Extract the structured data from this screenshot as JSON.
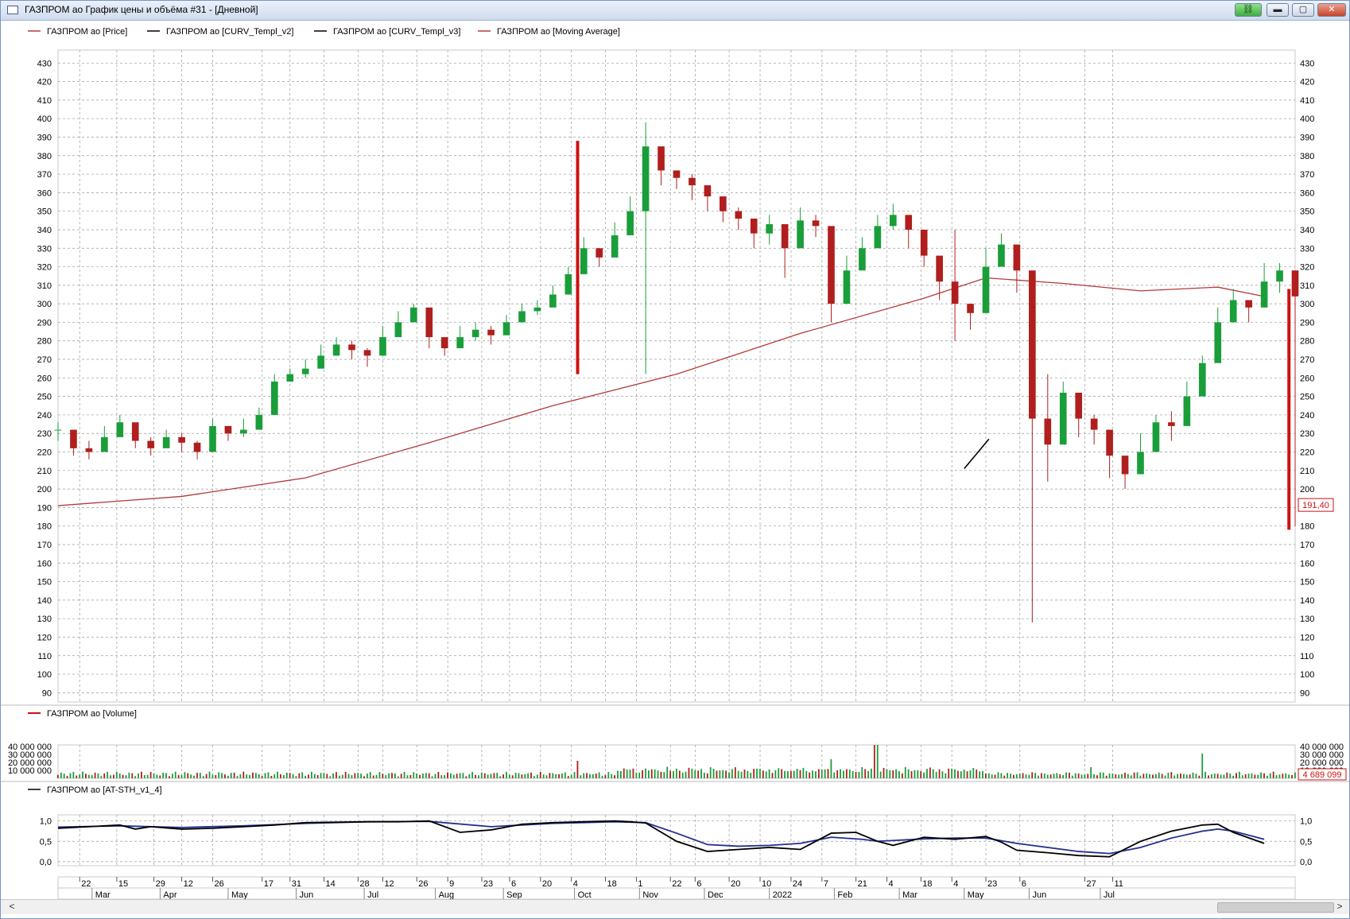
{
  "window": {
    "title": "ГАЗПРОМ ао График цены и объёма #31 - [Дневной]",
    "buttons": {
      "minimize": "▬",
      "maximize": "▢",
      "close": "✕",
      "link": "⛓"
    }
  },
  "colors": {
    "up": "#1a9e3a",
    "down": "#b01e1e",
    "ma": "#b33a3a",
    "grid": "#9a9a9a",
    "fast": "#000000",
    "slow": "#1f2f8f",
    "marker": "#cc1111"
  },
  "chart_data": [
    {
      "type": "line",
      "name": "price-panel",
      "legend": [
        "ГАЗПРОМ ао [Price]",
        "ГАЗПРОМ ао [CURV_Templ_v2]",
        "ГАЗПРОМ ао [CURV_Templ_v3]",
        "ГАЗПРОМ ао [Moving Average]"
      ],
      "ylim": [
        85,
        437
      ],
      "yticks": [
        90,
        100,
        110,
        120,
        130,
        140,
        150,
        160,
        170,
        180,
        190,
        200,
        210,
        220,
        230,
        240,
        250,
        260,
        270,
        280,
        290,
        300,
        310,
        320,
        330,
        340,
        350,
        360,
        370,
        380,
        390,
        400,
        410,
        420,
        430
      ],
      "price_series": {
        "name": "ГАЗПРОМ ао [Price]",
        "x": [
          0,
          5,
          10,
          15,
          20,
          25,
          30,
          35,
          40,
          45,
          50,
          55,
          60,
          65,
          70,
          75,
          80,
          85,
          90,
          95,
          100,
          105,
          110,
          115,
          120,
          125,
          130,
          135,
          140,
          145,
          150,
          155,
          160,
          165,
          170,
          175,
          180,
          185,
          190,
          195,
          200,
          205,
          210,
          215,
          220,
          225,
          230,
          235,
          240,
          245,
          250,
          255,
          260,
          265,
          270,
          275,
          280,
          285,
          290,
          295,
          300,
          305,
          310,
          315,
          320,
          325,
          330,
          335,
          340,
          345,
          350,
          355,
          360,
          365,
          370,
          375,
          380,
          385,
          390,
          395,
          400
        ],
        "y": [
          232,
          222,
          220,
          228,
          236,
          226,
          222,
          228,
          225,
          220,
          234,
          230,
          232,
          240,
          258,
          262,
          265,
          272,
          278,
          275,
          272,
          282,
          290,
          298,
          282,
          276,
          282,
          286,
          283,
          290,
          296,
          298,
          305,
          316,
          330,
          325,
          337,
          350,
          385,
          372,
          368,
          364,
          358,
          350,
          346,
          338,
          343,
          330,
          345,
          342,
          300,
          318,
          330,
          342,
          348,
          340,
          326,
          312,
          300,
          295,
          320,
          332,
          318,
          238,
          224,
          252,
          238,
          232,
          218,
          208,
          220,
          236,
          234,
          250,
          268,
          290,
          302,
          298,
          312,
          318,
          304
        ],
        "high": [
          236,
          228,
          226,
          234,
          240,
          232,
          228,
          232,
          230,
          226,
          238,
          234,
          238,
          244,
          262,
          265,
          270,
          278,
          282,
          280,
          276,
          288,
          296,
          300,
          288,
          280,
          288,
          290,
          288,
          294,
          300,
          302,
          310,
          320,
          336,
          330,
          344,
          358,
          398,
          378,
          372,
          370,
          362,
          354,
          352,
          346,
          348,
          338,
          352,
          348,
          318,
          326,
          336,
          348,
          354,
          346,
          330,
          318,
          340,
          300,
          330,
          338,
          326,
          284,
          262,
          258,
          246,
          240,
          224,
          216,
          230,
          240,
          242,
          258,
          272,
          298,
          308,
          302,
          322,
          322,
          310
        ],
        "low": [
          226,
          218,
          216,
          222,
          230,
          222,
          218,
          224,
          220,
          216,
          228,
          226,
          228,
          236,
          252,
          258,
          260,
          268,
          272,
          270,
          266,
          276,
          284,
          292,
          276,
          272,
          276,
          280,
          278,
          286,
          290,
          294,
          300,
          310,
          322,
          320,
          330,
          344,
          262,
          364,
          362,
          356,
          350,
          344,
          340,
          330,
          332,
          314,
          330,
          336,
          290,
          304,
          322,
          334,
          340,
          330,
          320,
          302,
          280,
          286,
          310,
          324,
          306,
          128,
          204,
          244,
          228,
          224,
          206,
          200,
          210,
          228,
          226,
          244,
          258,
          284,
          298,
          290,
          304,
          306,
          180
        ]
      },
      "moving_average": {
        "name": "ГАЗПРОМ ао [Moving Average]",
        "x": [
          0,
          40,
          80,
          120,
          160,
          200,
          240,
          280,
          300,
          325,
          350,
          375,
          390
        ],
        "y": [
          191,
          196,
          206,
          225,
          245,
          262,
          284,
          303,
          314,
          311,
          307,
          309,
          304
        ]
      },
      "trend_segment": {
        "x": [
          293,
          301
        ],
        "y": [
          211,
          227
        ]
      },
      "markers": [
        {
          "x": 168,
          "y1": 262,
          "y2": 388
        },
        {
          "x": 398,
          "y1": 178,
          "y2": 308
        }
      ],
      "last_price_label": "191,40",
      "last_price": 191.4
    },
    {
      "type": "bar",
      "name": "volume-panel",
      "legend": [
        "ГАЗПРОМ ао [Volume]"
      ],
      "ylim": [
        0,
        42000000
      ],
      "yticks": [
        "10 000 000",
        "20 000 000",
        "30 000 000",
        "40 000 000"
      ],
      "ytick_values": [
        10000000,
        20000000,
        30000000,
        40000000
      ],
      "spikes": [
        {
          "x": 168,
          "v": 22000000
        },
        {
          "x": 250,
          "v": 24000000
        },
        {
          "x": 264,
          "v": 42000000
        },
        {
          "x": 265,
          "v": 42000000
        },
        {
          "x": 334,
          "v": 14000000
        },
        {
          "x": 370,
          "v": 31000000
        }
      ],
      "last_volume_label": "4 689 099"
    },
    {
      "type": "line",
      "name": "oscillator-panel",
      "legend": [
        "ГАЗПРОМ ао [AT-STH_v1_4]"
      ],
      "ylim": [
        -0.1,
        1.15
      ],
      "yticks": [
        "0,0",
        "0,5",
        "1,0"
      ],
      "ytick_values": [
        0,
        0.5,
        1.0
      ],
      "fast": {
        "x": [
          0,
          10,
          20,
          25,
          30,
          40,
          50,
          60,
          70,
          80,
          100,
          110,
          120,
          130,
          140,
          150,
          160,
          170,
          180,
          185,
          190,
          200,
          210,
          220,
          230,
          240,
          250,
          258,
          265,
          270,
          280,
          290,
          300,
          305,
          310,
          320,
          330,
          340,
          350,
          360,
          370,
          375,
          380,
          390
        ],
        "y": [
          0.82,
          0.86,
          0.9,
          0.8,
          0.86,
          0.8,
          0.82,
          0.86,
          0.9,
          0.96,
          0.98,
          0.98,
          1.0,
          0.72,
          0.78,
          0.92,
          0.96,
          0.98,
          1.0,
          0.98,
          0.95,
          0.5,
          0.25,
          0.3,
          0.35,
          0.3,
          0.7,
          0.72,
          0.5,
          0.4,
          0.6,
          0.55,
          0.62,
          0.48,
          0.28,
          0.22,
          0.15,
          0.12,
          0.5,
          0.75,
          0.9,
          0.92,
          0.72,
          0.45
        ]
      },
      "slow": {
        "x": [
          0,
          20,
          40,
          60,
          80,
          100,
          120,
          140,
          160,
          180,
          190,
          200,
          210,
          220,
          230,
          240,
          250,
          260,
          265,
          270,
          280,
          290,
          300,
          310,
          320,
          330,
          340,
          350,
          360,
          370,
          375,
          380,
          390
        ],
        "y": [
          0.85,
          0.88,
          0.84,
          0.88,
          0.94,
          0.98,
          0.99,
          0.86,
          0.94,
          0.98,
          0.96,
          0.7,
          0.42,
          0.38,
          0.4,
          0.45,
          0.6,
          0.55,
          0.5,
          0.52,
          0.56,
          0.58,
          0.58,
          0.45,
          0.35,
          0.25,
          0.2,
          0.35,
          0.58,
          0.75,
          0.8,
          0.75,
          0.55
        ]
      }
    }
  ],
  "x_axis": {
    "days": [
      {
        "x": 7,
        "label": "22"
      },
      {
        "x": 19,
        "label": "15"
      },
      {
        "x": 31,
        "label": "29"
      },
      {
        "x": 40,
        "label": "12"
      },
      {
        "x": 50,
        "label": "26"
      },
      {
        "x": 66,
        "label": "17"
      },
      {
        "x": 75,
        "label": "31"
      },
      {
        "x": 86,
        "label": "14"
      },
      {
        "x": 97,
        "label": "28"
      },
      {
        "x": 105,
        "label": "12"
      },
      {
        "x": 116,
        "label": "26"
      },
      {
        "x": 126,
        "label": "9"
      },
      {
        "x": 137,
        "label": "23"
      },
      {
        "x": 146,
        "label": "6"
      },
      {
        "x": 156,
        "label": "20"
      },
      {
        "x": 166,
        "label": "4"
      },
      {
        "x": 177,
        "label": "18"
      },
      {
        "x": 187,
        "label": "1"
      },
      {
        "x": 198,
        "label": "22"
      },
      {
        "x": 206,
        "label": "6"
      },
      {
        "x": 217,
        "label": "20"
      },
      {
        "x": 227,
        "label": "10"
      },
      {
        "x": 237,
        "label": "24"
      },
      {
        "x": 247,
        "label": "7"
      },
      {
        "x": 258,
        "label": "21"
      },
      {
        "x": 268,
        "label": "4"
      },
      {
        "x": 279,
        "label": "18"
      },
      {
        "x": 289,
        "label": "4"
      },
      {
        "x": 300,
        "label": "23"
      },
      {
        "x": 311,
        "label": "6"
      },
      {
        "x": 332,
        "label": "27"
      },
      {
        "x": 341,
        "label": "11"
      }
    ],
    "months": [
      {
        "x": 11,
        "label": "Mar"
      },
      {
        "x": 33,
        "label": "Apr"
      },
      {
        "x": 55,
        "label": "May"
      },
      {
        "x": 77,
        "label": "Jun"
      },
      {
        "x": 99,
        "label": "Jul"
      },
      {
        "x": 122,
        "label": "Aug"
      },
      {
        "x": 144,
        "label": "Sep"
      },
      {
        "x": 167,
        "label": "Oct"
      },
      {
        "x": 188,
        "label": "Nov"
      },
      {
        "x": 209,
        "label": "Dec"
      },
      {
        "x": 230,
        "label": "2022"
      },
      {
        "x": 251,
        "label": "Feb"
      },
      {
        "x": 272,
        "label": "Mar"
      },
      {
        "x": 293,
        "label": "May"
      },
      {
        "x": 314,
        "label": "Jun"
      },
      {
        "x": 337,
        "label": "Jul"
      }
    ],
    "domain": [
      0,
      400
    ]
  }
}
